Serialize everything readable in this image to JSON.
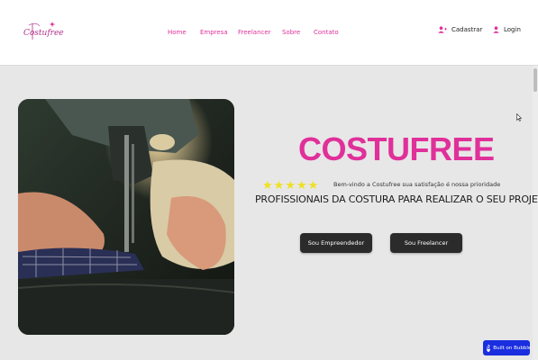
{
  "header": {
    "logo_text": "Costufree",
    "nav": [
      "Home",
      "Empresa",
      "Freelancer",
      "Sobre",
      "Contato"
    ],
    "signup_label": "Cadastrar",
    "login_label": "Login"
  },
  "hero": {
    "title": "COSTUFREE",
    "rating_stars": 5,
    "welcome": "Bem-vindo a Costufree sua satisfação é nossa prioridade",
    "tagline": "PROFISSIONAIS DA COSTURA PARA REALIZAR O SEU PROJETO",
    "btn_entrepreneur": "Sou Empreendedor",
    "btn_freelancer": "Sou Freelancer",
    "image_icon": "sewing-machine-photo"
  },
  "badge": {
    "label": "Built on Bubble"
  },
  "colors": {
    "accent": "#e0309a",
    "button_bg": "#2b2b2b",
    "star": "#f0e020",
    "bubble_blue": "#1a2ee0"
  }
}
